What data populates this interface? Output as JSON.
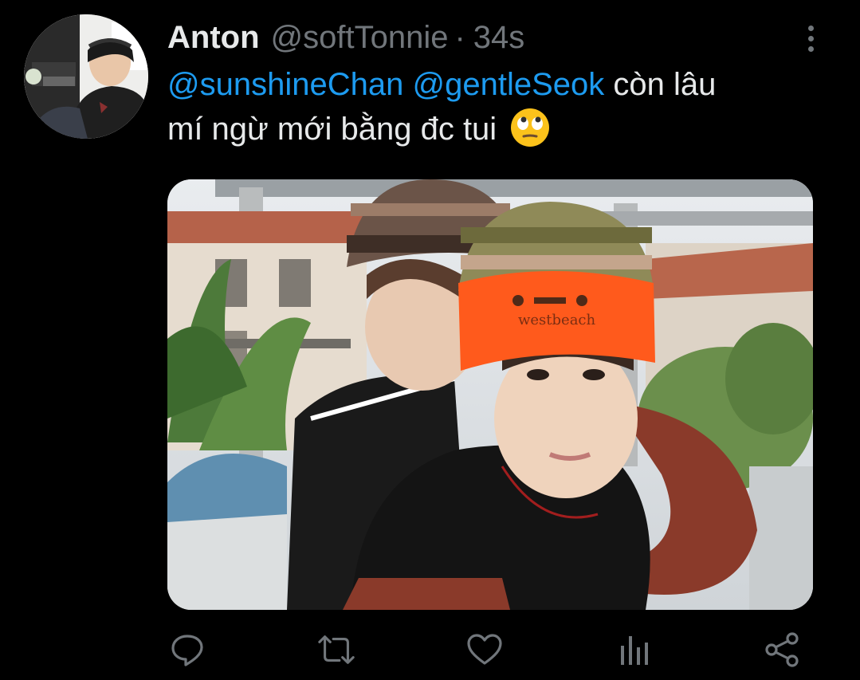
{
  "tweet": {
    "author": {
      "display_name": "Anton",
      "handle": "@softTonnie",
      "separator": "·",
      "timestamp": "34s",
      "avatar_icon": "profile-photo"
    },
    "text": {
      "mention_1": "@sunshineChan",
      "mention_2": "@gentleSeok",
      "body_line_1": " còn lâu",
      "body_line_2": "mí ngừ mới bằng đc tui ",
      "emoji": "face-with-rolling-eyes"
    },
    "media": {
      "beanie_text": "westbeach"
    },
    "actions": {
      "reply_icon": "reply-icon",
      "retweet_icon": "retweet-icon",
      "like_icon": "heart-icon",
      "views_icon": "analytics-icon",
      "share_icon": "share-icon"
    }
  },
  "colors": {
    "background": "#000000",
    "text_primary": "#e7e9ea",
    "text_secondary": "#71767b",
    "accent": "#1d9bf0"
  }
}
